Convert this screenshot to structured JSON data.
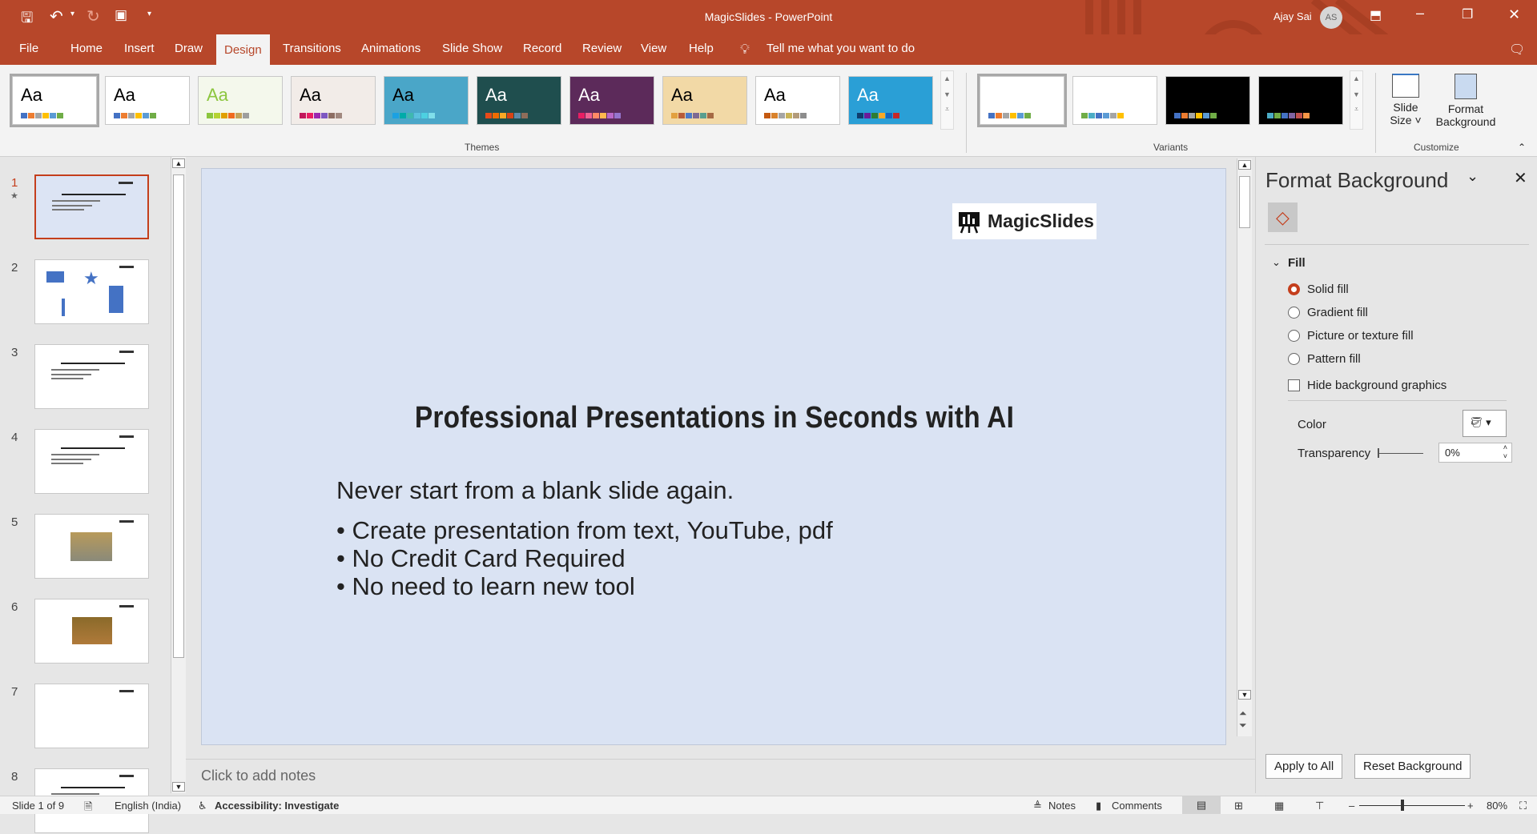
{
  "titlebar": {
    "title": "MagicSlides  -  PowerPoint",
    "user": "Ajay Sai",
    "initials": "AS"
  },
  "tabs": [
    "File",
    "Home",
    "Insert",
    "Draw",
    "Design",
    "Transitions",
    "Animations",
    "Slide Show",
    "Record",
    "Review",
    "View",
    "Help"
  ],
  "active_tab": "Design",
  "tell_me": "Tell me what you want to do",
  "ribbon": {
    "theme_sample": "Aa",
    "themes_label": "Themes",
    "variants_label": "Variants",
    "customize_label": "Customize",
    "slide_size": [
      "Slide",
      "Size ˅"
    ],
    "format_background": [
      "Format",
      "Background"
    ]
  },
  "themes": [
    {
      "bg": "#ffffff",
      "fg": "#000",
      "sw": [
        "#4472c4",
        "#ed7d31",
        "#a5a5a5",
        "#ffc000",
        "#5b9bd5",
        "#70ad47"
      ]
    },
    {
      "bg": "#ffffff",
      "fg": "#000",
      "sw": [
        "#4472c4",
        "#ed7d31",
        "#a5a5a5",
        "#ffc000",
        "#5b9bd5",
        "#70ad47"
      ]
    },
    {
      "bg": "#f4f8ec",
      "fg": "#8cc63f",
      "sw": [
        "#8cc63f",
        "#b5d334",
        "#e0a000",
        "#f06a1e",
        "#c4a35a",
        "#9e9e9e"
      ]
    },
    {
      "bg": "#f2ece8",
      "fg": "#000",
      "sw": [
        "#c2185b",
        "#e91e63",
        "#9c27b0",
        "#7e57c2",
        "#8d6e63",
        "#a1887f"
      ]
    },
    {
      "bg": "#4aa6c8",
      "fg": "#000",
      "sw": [
        "#1ba1e2",
        "#00aba9",
        "#3fb8af",
        "#5bc0de",
        "#4dd0e1",
        "#80deea"
      ]
    },
    {
      "bg": "#1f4e4e",
      "fg": "#fff",
      "sw": [
        "#e64a19",
        "#ef6c00",
        "#f9a825",
        "#d84315",
        "#5d8aa8",
        "#8e6d5a"
      ]
    },
    {
      "bg": "#5c2a5a",
      "fg": "#fff",
      "sw": [
        "#e91e63",
        "#f06292",
        "#ff8a65",
        "#ffb74d",
        "#ba68c8",
        "#9575cd"
      ]
    },
    {
      "bg": "#f2d9a6",
      "fg": "#000",
      "sw": [
        "#e2a03f",
        "#b85c38",
        "#4e7ac7",
        "#7f6a93",
        "#5a9e8f",
        "#a66a44"
      ]
    },
    {
      "bg": "#ffffff",
      "fg": "#000",
      "sw": [
        "#c55a11",
        "#d9822b",
        "#a5a5a5",
        "#c9b458",
        "#b39b7a",
        "#8d8d8d"
      ]
    },
    {
      "bg": "#2a9fd6",
      "fg": "#fff",
      "sw": [
        "#0f3d6e",
        "#6a1b9a",
        "#2e7d32",
        "#f9a825",
        "#1565c0",
        "#c62828"
      ]
    }
  ],
  "variants": [
    {
      "bg": "#ffffff",
      "sw": [
        "#4472c4",
        "#ed7d31",
        "#a5a5a5",
        "#ffc000",
        "#5b9bd5",
        "#70ad47"
      ]
    },
    {
      "bg": "#ffffff",
      "sw": [
        "#70ad47",
        "#4bacc6",
        "#4472c4",
        "#5b9bd5",
        "#a5a5a5",
        "#ffc000"
      ]
    },
    {
      "bg": "#000000",
      "sw": [
        "#4472c4",
        "#ed7d31",
        "#a5a5a5",
        "#ffc000",
        "#5b9bd5",
        "#70ad47"
      ]
    },
    {
      "bg": "#000000",
      "sw": [
        "#4bacc6",
        "#70ad47",
        "#4472c4",
        "#8064a2",
        "#c0504d",
        "#f79646"
      ]
    }
  ],
  "thumbnails": [
    "1",
    "2",
    "3",
    "4",
    "5",
    "6",
    "7",
    "8"
  ],
  "slide": {
    "logo": "MagicSlides",
    "title": "Professional Presentations in Seconds with AI",
    "subtitle": "Never start from a blank slide again.",
    "bullets": [
      "• Create presentation from text, YouTube, pdf",
      "• No Credit Card Required",
      "• No need to learn new tool"
    ],
    "background": "#dae3f3"
  },
  "notes_placeholder": "Click to add notes",
  "panel": {
    "title": "Format Background",
    "section": "Fill",
    "options": [
      {
        "label": "Solid fill",
        "selected": true
      },
      {
        "label": "Gradient fill",
        "selected": false
      },
      {
        "label": "Picture or texture fill",
        "selected": false
      },
      {
        "label": "Pattern fill",
        "selected": false
      }
    ],
    "hide_graphics": "Hide background graphics",
    "color_label": "Color",
    "transparency_label": "Transparency",
    "transparency_value": "0%",
    "apply_all": "Apply to All",
    "reset": "Reset Background"
  },
  "status": {
    "slide": "Slide 1 of 9",
    "language": "English (India)",
    "accessibility": "Accessibility: Investigate",
    "notes": "Notes",
    "comments": "Comments",
    "zoom": "80%"
  }
}
